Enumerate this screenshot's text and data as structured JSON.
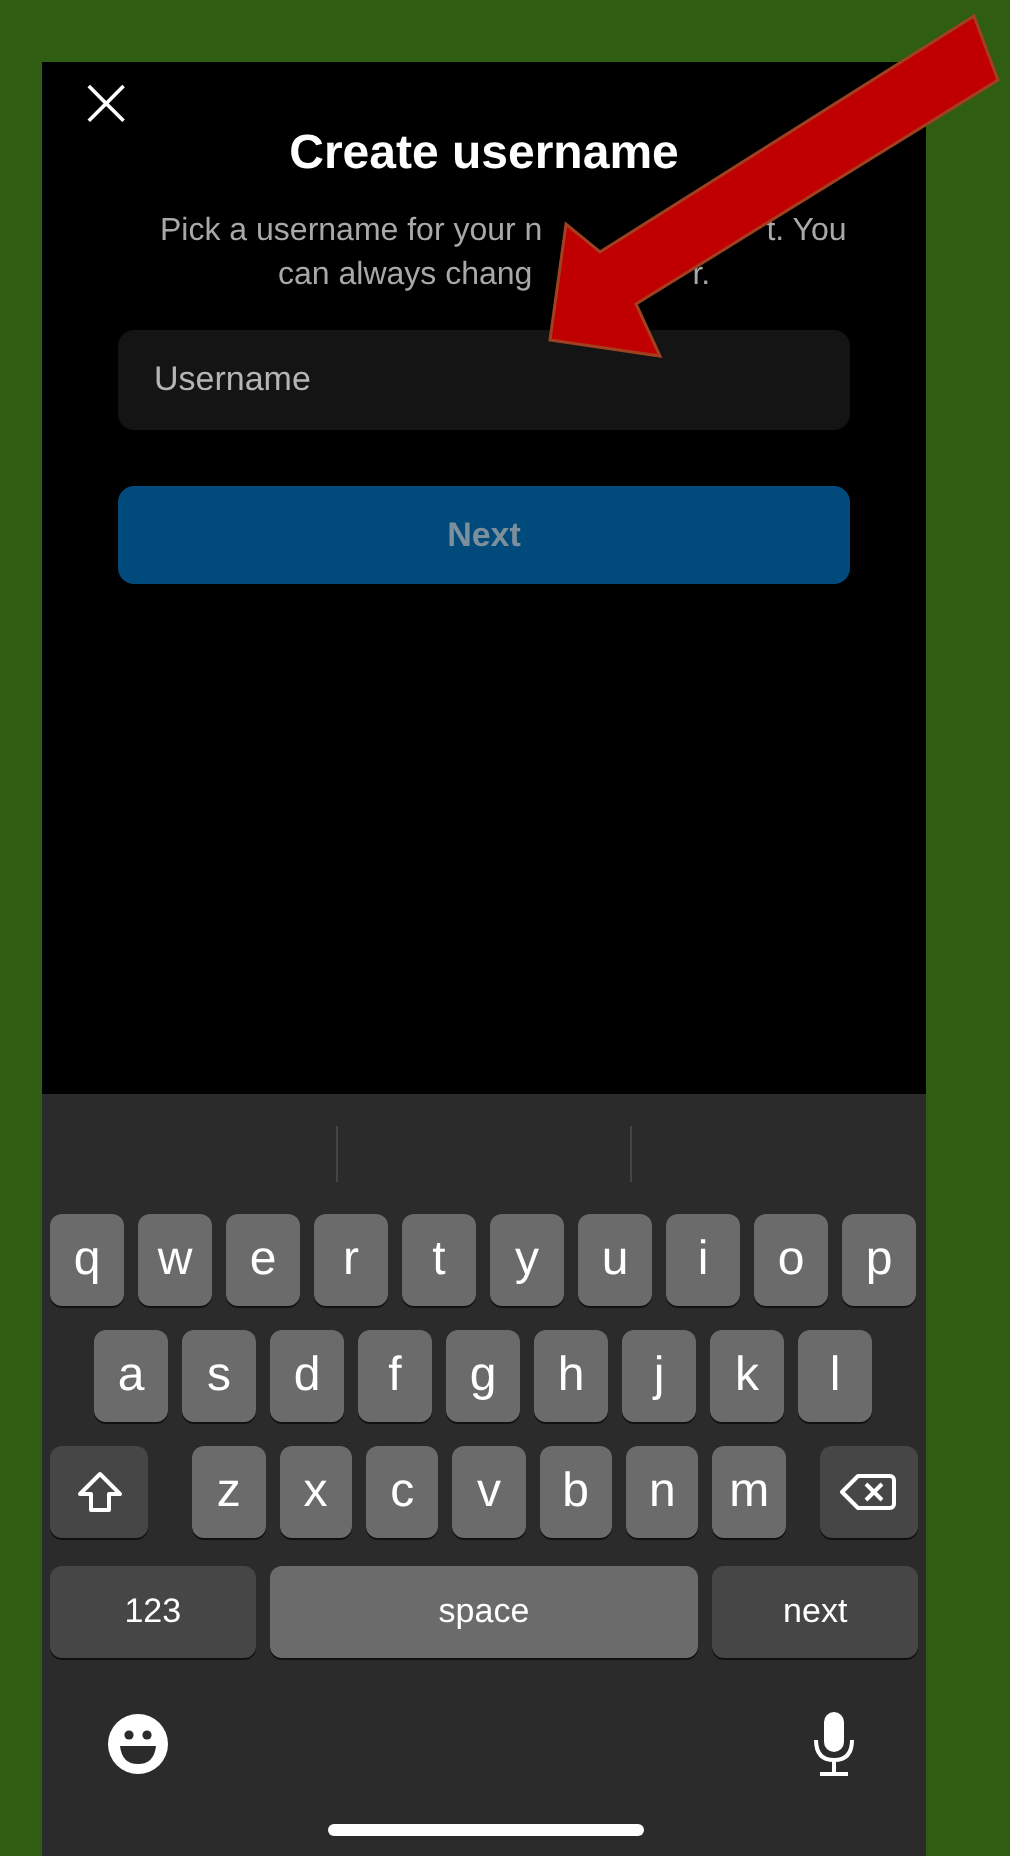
{
  "close_icon": "×",
  "title": "Create username",
  "subtitle_lines": [
    {
      "parts": [
        "Pick a username for your n",
        "t. You"
      ]
    },
    {
      "parts": [
        "can always chang",
        "r."
      ]
    }
  ],
  "username_field": {
    "placeholder": "Username"
  },
  "next_button": {
    "label": "Next",
    "disabled": true
  },
  "keyboard": {
    "rows": [
      {
        "keys": [
          {
            "kind": "letter",
            "label": "q"
          },
          {
            "kind": "letter",
            "label": "w"
          },
          {
            "kind": "letter",
            "label": "e"
          },
          {
            "kind": "letter",
            "label": "r"
          },
          {
            "kind": "letter",
            "label": "t"
          },
          {
            "kind": "letter",
            "label": "y"
          },
          {
            "kind": "letter",
            "label": "u"
          },
          {
            "kind": "letter",
            "label": "i"
          },
          {
            "kind": "letter",
            "label": "o"
          },
          {
            "kind": "letter",
            "label": "p"
          }
        ]
      },
      {
        "keys": [
          {
            "kind": "letter",
            "label": "a"
          },
          {
            "kind": "letter",
            "label": "s"
          },
          {
            "kind": "letter",
            "label": "d"
          },
          {
            "kind": "letter",
            "label": "f"
          },
          {
            "kind": "letter",
            "label": "g"
          },
          {
            "kind": "letter",
            "label": "h"
          },
          {
            "kind": "letter",
            "label": "j"
          },
          {
            "kind": "letter",
            "label": "k"
          },
          {
            "kind": "letter",
            "label": "l"
          }
        ]
      },
      {
        "keys": [
          {
            "kind": "shift"
          },
          {
            "kind": "letter",
            "label": "z"
          },
          {
            "kind": "letter",
            "label": "x"
          },
          {
            "kind": "letter",
            "label": "c"
          },
          {
            "kind": "letter",
            "label": "v"
          },
          {
            "kind": "letter",
            "label": "b"
          },
          {
            "kind": "letter",
            "label": "n"
          },
          {
            "kind": "letter",
            "label": "m"
          },
          {
            "kind": "delete"
          }
        ]
      },
      {
        "keys": [
          {
            "kind": "mode",
            "label": "123"
          },
          {
            "kind": "space",
            "label": "space"
          },
          {
            "kind": "return",
            "label": "next"
          }
        ]
      }
    ]
  }
}
